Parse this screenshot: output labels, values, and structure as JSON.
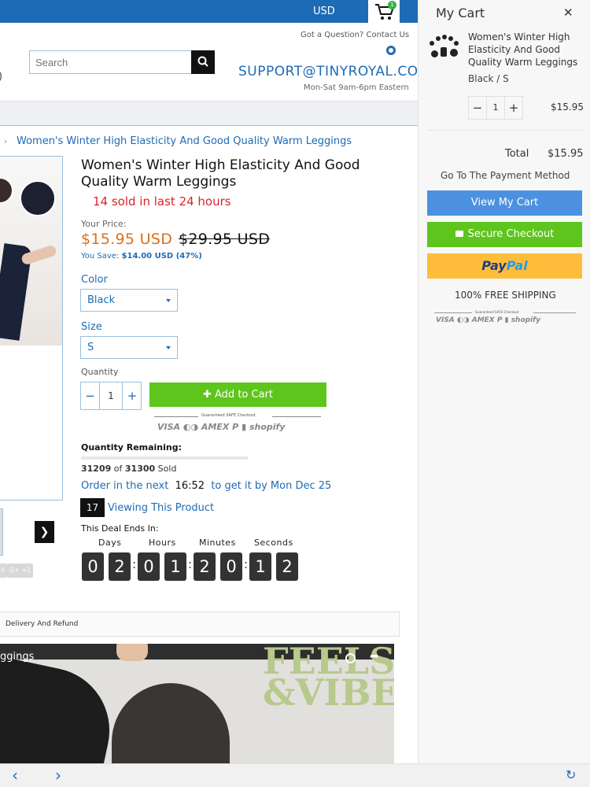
{
  "header": {
    "currency": "USD",
    "cart_count": "1",
    "question": "Got a Question? Contact Us",
    "search_placeholder": "Search",
    "support_email": "SUPPORT@TINYROYAL.COM",
    "support_hours": "Mon-Sat 9am-6pm Eastern"
  },
  "breadcrumb": "Women's Winter High Elasticity And Good Quality Warm Leggings",
  "product": {
    "title": "Women's Winter High Elasticity And Good Quality Warm Leggings",
    "sold_24h": "14 sold in last 24 hours",
    "price_label": "Your Price:",
    "price": "$15.95 USD",
    "compare_price": "$29.95 USD",
    "save_label": "You Save:",
    "save_value": "$14.00 USD (47%)",
    "color_label": "Color",
    "color_value": "Black",
    "size_label": "Size",
    "size_value": "S",
    "quantity_label": "Quantity",
    "quantity": "1",
    "add_to_cart": "Add to Cart",
    "secure_badge_text": "Guaranteed SAFE Checkout",
    "payment_logos": "VISA  ◐◑  AMEX  P  ▮  shopify",
    "quantity_remaining_label": "Quantity Remaining:",
    "sold_count": "31209",
    "sold_of": "of",
    "sold_total": "31300",
    "sold_word": "Sold",
    "remaining_fraction": 0.997,
    "order_prefix": "Order in the next",
    "order_time": "16:52",
    "order_suffix": "to get it by Mon Dec 25",
    "viewing_count": "17",
    "viewing_text": "Viewing This Product",
    "deal_ends": "This Deal Ends In:",
    "countdown_labels": [
      "Days",
      "Hours",
      "Minutes",
      "Seconds"
    ],
    "countdown_digits": [
      "0",
      "2",
      "0",
      "1",
      "2",
      "0",
      "1",
      "2"
    ],
    "share_chips": [
      "0",
      "G+ +1"
    ],
    "tab_delivery": "Delivery And Refund",
    "video_caption": "ggings",
    "video_brand_1": "FEELS",
    "video_brand_2": "&VIBES"
  },
  "cart": {
    "title": "My Cart",
    "item_name": "Women's Winter High Elasticity And Good Quality Warm Leggings",
    "item_variant": "Black / S",
    "item_qty": "1",
    "item_price": "$15.95",
    "total_label": "Total",
    "total_value": "$15.95",
    "payment_method": "Go To The Payment Method",
    "view_cart": "View My Cart",
    "secure_checkout": "Secure Checkout",
    "paypal_pay": "Pay",
    "paypal_pal": "Pal",
    "free_shipping": "100% FREE SHIPPING",
    "badge_text": "Guaranteed SAFE Checkout",
    "payment_logos": "VISA  ◐◑  AMEX  P  ▮  shopify"
  },
  "colors": {
    "brand_blue": "#1e6bb5",
    "add_green": "#5ec51d",
    "price_orange": "#d9711e",
    "alert_red": "#d9242b",
    "view_cart_blue": "#4c91df",
    "paypal_yellow": "#fdbd3b"
  },
  "icons": [
    "cart-icon",
    "search-icon",
    "chat-icon",
    "close-icon",
    "lock-icon",
    "chevron-left-icon",
    "chevron-right-icon",
    "reload-icon",
    "play-icon"
  ]
}
